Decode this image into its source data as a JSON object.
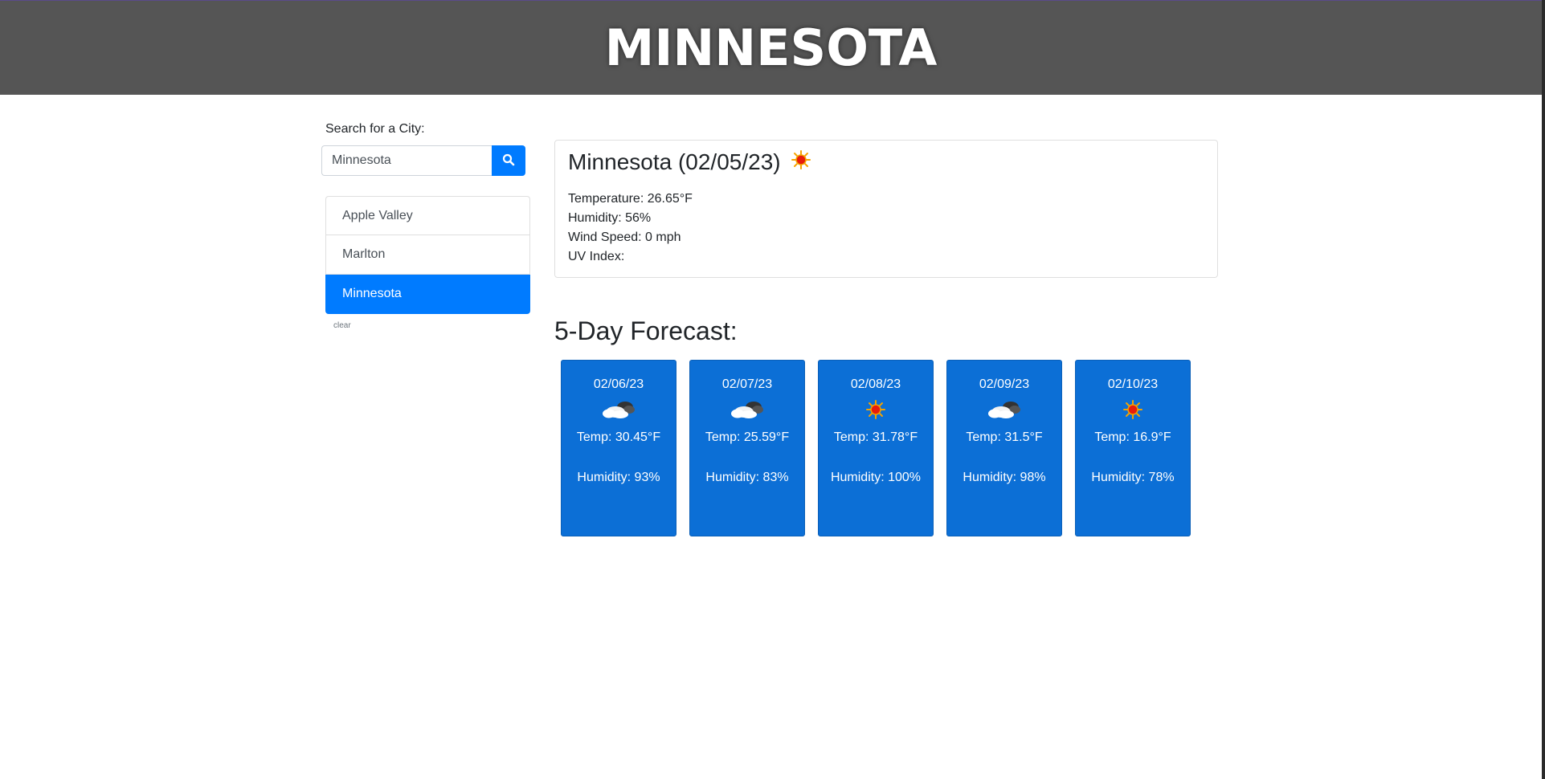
{
  "header": {
    "title": "MINNESOTA"
  },
  "search": {
    "label": "Search for a City:",
    "value": "Minnesota",
    "button_icon": "search-icon"
  },
  "cities": [
    {
      "name": "Apple Valley",
      "active": false
    },
    {
      "name": "Marlton",
      "active": false
    },
    {
      "name": "Minnesota",
      "active": true
    }
  ],
  "clear_label": "clear",
  "current": {
    "title": "Minnesota (02/05/23)",
    "icon": "sun-icon",
    "temperature": "Temperature: 26.65°F",
    "humidity": "Humidity: 56%",
    "wind": "Wind Speed: 0 mph",
    "uv": "UV Index:"
  },
  "forecast": {
    "heading": "5-Day Forecast:",
    "days": [
      {
        "date": "02/06/23",
        "icon": "cloud-icon",
        "temp": "Temp: 30.45°F",
        "humidity": "Humidity: 93%"
      },
      {
        "date": "02/07/23",
        "icon": "cloud-icon",
        "temp": "Temp: 25.59°F",
        "humidity": "Humidity: 83%"
      },
      {
        "date": "02/08/23",
        "icon": "sun-icon",
        "temp": "Temp: 31.78°F",
        "humidity": "Humidity: 100%"
      },
      {
        "date": "02/09/23",
        "icon": "cloud-icon",
        "temp": "Temp: 31.5°F",
        "humidity": "Humidity: 98%"
      },
      {
        "date": "02/10/23",
        "icon": "sun-icon",
        "temp": "Temp: 16.9°F",
        "humidity": "Humidity: 78%"
      }
    ]
  },
  "colors": {
    "header_bg": "#555555",
    "accent": "#007bff",
    "forecast_card": "#0c6fd6"
  }
}
